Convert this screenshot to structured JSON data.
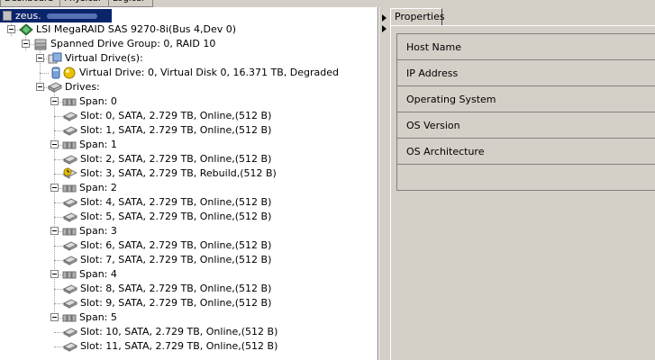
{
  "top_tabs": [
    "Dashboard",
    "Physical",
    "Logical"
  ],
  "tree": {
    "host_label": "zeus.",
    "controller": "LSI MegaRAID SAS 9270-8i(Bus 4,Dev 0)",
    "drive_group": "Spanned Drive Group: 0, RAID  10",
    "virtual_drives_label": "Virtual Drive(s):",
    "virtual_drive": "Virtual Drive: 0, Virtual Disk 0, 16.371 TB, Degraded",
    "drives_label": "Drives:",
    "spans": [
      {
        "label": "Span: 0",
        "slots": [
          "Slot: 0, SATA, 2.729 TB, Online,(512 B)",
          "Slot: 1, SATA, 2.729 TB, Online,(512 B)"
        ]
      },
      {
        "label": "Span: 1",
        "slots": [
          "Slot: 2, SATA, 2.729 TB, Online,(512 B)",
          "Slot: 3, SATA, 2.729 TB, Rebuild,(512 B)"
        ]
      },
      {
        "label": "Span: 2",
        "slots": [
          "Slot: 4, SATA, 2.729 TB, Online,(512 B)",
          "Slot: 5, SATA, 2.729 TB, Online,(512 B)"
        ]
      },
      {
        "label": "Span: 3",
        "slots": [
          "Slot: 6, SATA, 2.729 TB, Online,(512 B)",
          "Slot: 7, SATA, 2.729 TB, Online,(512 B)"
        ]
      },
      {
        "label": "Span: 4",
        "slots": [
          "Slot: 8, SATA, 2.729 TB, Online,(512 B)",
          "Slot: 9, SATA, 2.729 TB, Online,(512 B)"
        ]
      },
      {
        "label": "Span: 5",
        "slots": [
          "Slot: 10, SATA, 2.729 TB, Online,(512 B)",
          "Slot: 11, SATA, 2.729 TB, Online,(512 B)"
        ]
      }
    ]
  },
  "properties": {
    "tab_label": "Properties",
    "rows": [
      "Host Name",
      "IP Address",
      "Operating System",
      "OS Version",
      "OS Architecture",
      ""
    ]
  },
  "colors": {
    "selection": "#0a246a",
    "panel_bg": "#d4d0c8",
    "warning": "#e8c000"
  }
}
